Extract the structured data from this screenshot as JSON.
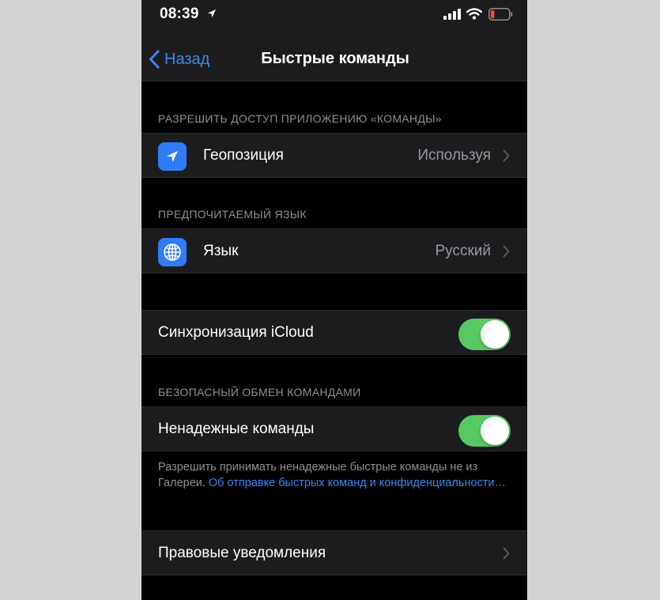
{
  "status_bar": {
    "time": "08:39",
    "icons": [
      "location-arrow-icon",
      "signal-bars-icon",
      "wifi-icon",
      "battery-low-icon"
    ],
    "battery_color": "#ff453a"
  },
  "nav": {
    "back_label": "Назад",
    "title": "Быстрые команды"
  },
  "sections": {
    "access": {
      "header": "РАЗРЕШИТЬ ДОСТУП ПРИЛОЖЕНИЮ «КОМАНДЫ»",
      "row": {
        "icon": "location-arrow-icon",
        "label": "Геопозиция",
        "value": "Используя"
      }
    },
    "language": {
      "header": "ПРЕДПОЧИТАЕМЫЙ ЯЗЫК",
      "row": {
        "icon": "globe-icon",
        "label": "Язык",
        "value": "Русский"
      }
    },
    "icloud": {
      "row": {
        "label": "Синхронизация iCloud",
        "toggle_on": true
      }
    },
    "sharing": {
      "header": "БЕЗОПАСНЫЙ ОБМЕН КОМАНДАМИ",
      "row": {
        "label": "Ненадежные команды",
        "toggle_on": true
      },
      "footnote_text": "Разрешить принимать ненадежные быстрые команды не из Галереи. ",
      "footnote_link": "Об отправке быстрых команд и конфиденциальности…"
    },
    "legal": {
      "row": {
        "label": "Правовые уведомления"
      }
    }
  },
  "colors": {
    "accent": "#3b86ef",
    "toggle_on": "#58c863",
    "icon_bg": "#2f7cf6",
    "cell_bg": "#1c1c1e",
    "page_bg": "#000000",
    "secondary_text": "#8e8e93"
  }
}
